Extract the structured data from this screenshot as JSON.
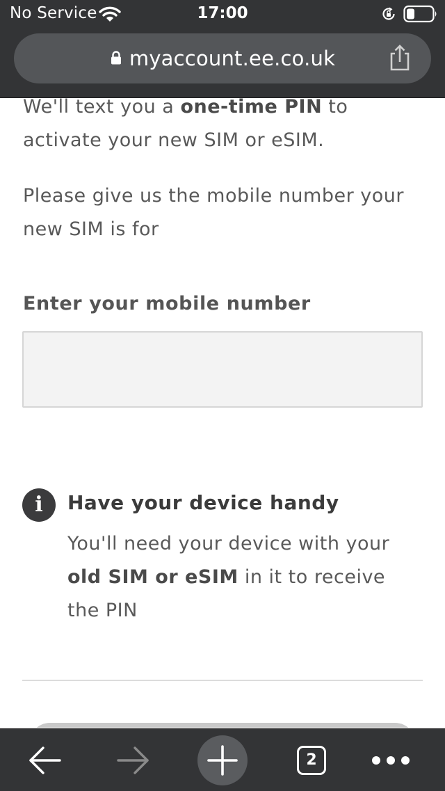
{
  "status_bar": {
    "carrier": "No Service",
    "time": "17:00"
  },
  "browser": {
    "url": "myaccount.ee.co.uk",
    "tabs_count": "2"
  },
  "page": {
    "intro": {
      "before": "We'll text you a ",
      "bold": "one-time PIN",
      "after": " to activate your new SIM or eSIM."
    },
    "request_text": "Please give us the mobile number your new SIM is for",
    "mobile_field": {
      "label": "Enter your mobile number",
      "value": "",
      "placeholder": ""
    },
    "notice": {
      "icon": "info-icon",
      "icon_glyph": "i",
      "title": "Have your device handy",
      "body_before": "You'll need your device with your ",
      "body_bold": "old SIM or eSIM",
      "body_after": " in it to receive the PIN"
    }
  },
  "colors": {
    "chrome_background": "#333436",
    "url_pill": "#545659",
    "body_text": "#595959",
    "input_background": "#f3f3f3",
    "input_border": "#d6d6d6",
    "info_icon": "#3b3b3d"
  }
}
